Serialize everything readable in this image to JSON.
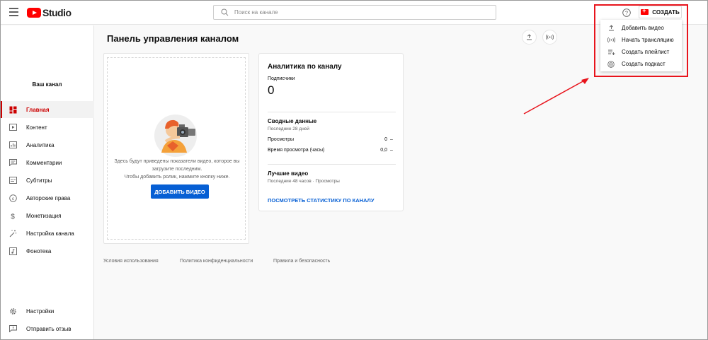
{
  "header": {
    "logo_text": "Studio",
    "search_placeholder": "Поиск на канале",
    "create_label": "СОЗДАТЬ"
  },
  "create_menu": {
    "items": [
      {
        "label": "Добавить видео",
        "icon": "upload-icon"
      },
      {
        "label": "Начать трансляцию",
        "icon": "broadcast-icon"
      },
      {
        "label": "Создать плейлист",
        "icon": "playlist-add-icon"
      },
      {
        "label": "Создать подкаст",
        "icon": "podcast-icon"
      }
    ]
  },
  "sidebar": {
    "channel_label": "Ваш канал",
    "items": [
      {
        "label": "Главная",
        "icon": "dashboard-icon",
        "active": true
      },
      {
        "label": "Контент",
        "icon": "content-icon"
      },
      {
        "label": "Аналитика",
        "icon": "analytics-icon"
      },
      {
        "label": "Комментарии",
        "icon": "comments-icon"
      },
      {
        "label": "Субтитры",
        "icon": "subtitles-icon"
      },
      {
        "label": "Авторские права",
        "icon": "copyright-icon"
      },
      {
        "label": "Монетизация",
        "icon": "dollar-icon"
      },
      {
        "label": "Настройка канала",
        "icon": "magic-wand-icon"
      },
      {
        "label": "Фонотека",
        "icon": "audio-library-icon"
      }
    ],
    "bottom_items": [
      {
        "label": "Настройки",
        "icon": "gear-icon"
      },
      {
        "label": "Отправить отзыв",
        "icon": "feedback-icon"
      }
    ]
  },
  "main": {
    "title": "Панель управления каналом",
    "upload_card": {
      "text_line1": "Здесь будут приведены показатели видео, которое вы",
      "text_line2": "загрузите последним.",
      "text_line3": "Чтобы добавить ролик, нажмите кнопку ниже.",
      "button_label": "ДОБАВИТЬ ВИДЕО"
    },
    "analytics_card": {
      "title": "Аналитика по каналу",
      "subscribers_label": "Подписчики",
      "subscribers_value": "0",
      "summary_title": "Сводные данные",
      "summary_period": "Последние 28 дней",
      "rows": [
        {
          "label": "Просмотры",
          "value": "0",
          "trend": "–"
        },
        {
          "label": "Время просмотра (часы)",
          "value": "0,0",
          "trend": "–"
        }
      ],
      "top_title": "Лучшие видео",
      "top_period": "Последние 48 часов · Просмотры",
      "link_label": "ПОСМОТРЕТЬ СТАТИСТИКУ ПО КАНАЛУ"
    }
  },
  "footer": {
    "links": [
      "Условия использования",
      "Политика конфиденциальности",
      "Правила и безопасность"
    ]
  },
  "colors": {
    "brand_red": "#ff0000",
    "accent_blue": "#065fd4",
    "annotation_red": "#e8141c"
  }
}
